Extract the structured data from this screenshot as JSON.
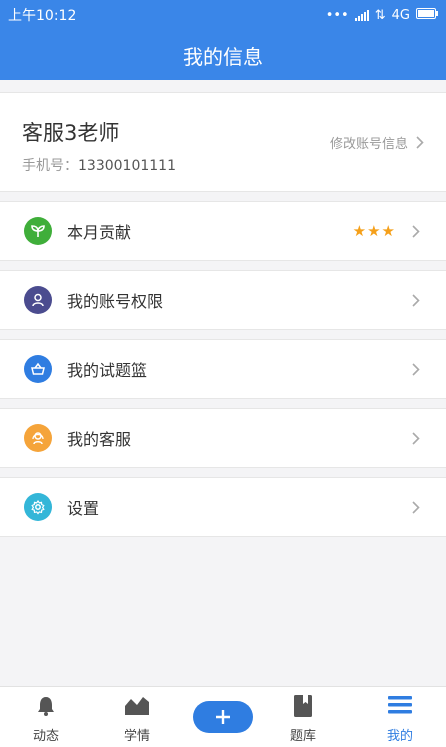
{
  "status_bar": {
    "time": "上午10:12",
    "dots": "•••",
    "network": "4G"
  },
  "header": {
    "title": "我的信息"
  },
  "profile": {
    "name": "客服3老师",
    "phone_label": "手机号：",
    "phone": "13300101111",
    "edit_label": "修改账号信息"
  },
  "menu": [
    {
      "label": "本月贡献",
      "icon": "sprout-icon",
      "color": "#3fae3a",
      "stars": "★★★"
    },
    {
      "label": "我的账号权限",
      "icon": "person-icon",
      "color": "#4b4c8f"
    },
    {
      "label": "我的试题篮",
      "icon": "basket-icon",
      "color": "#2f7de1"
    },
    {
      "label": "我的客服",
      "icon": "headset-icon",
      "color": "#f5a43a"
    },
    {
      "label": "设置",
      "icon": "gear-icon",
      "color": "#33b6d8"
    }
  ],
  "tabs": [
    {
      "label": "动态",
      "icon": "bell-icon"
    },
    {
      "label": "学情",
      "icon": "chart-icon"
    },
    {
      "label": "",
      "icon": "plus-icon"
    },
    {
      "label": "题库",
      "icon": "book-icon"
    },
    {
      "label": "我的",
      "icon": "menu-icon",
      "active": true
    }
  ],
  "colors": {
    "brand": "#3a86e8",
    "active_tab": "#2f7de1",
    "stars": "#f5a01a"
  }
}
